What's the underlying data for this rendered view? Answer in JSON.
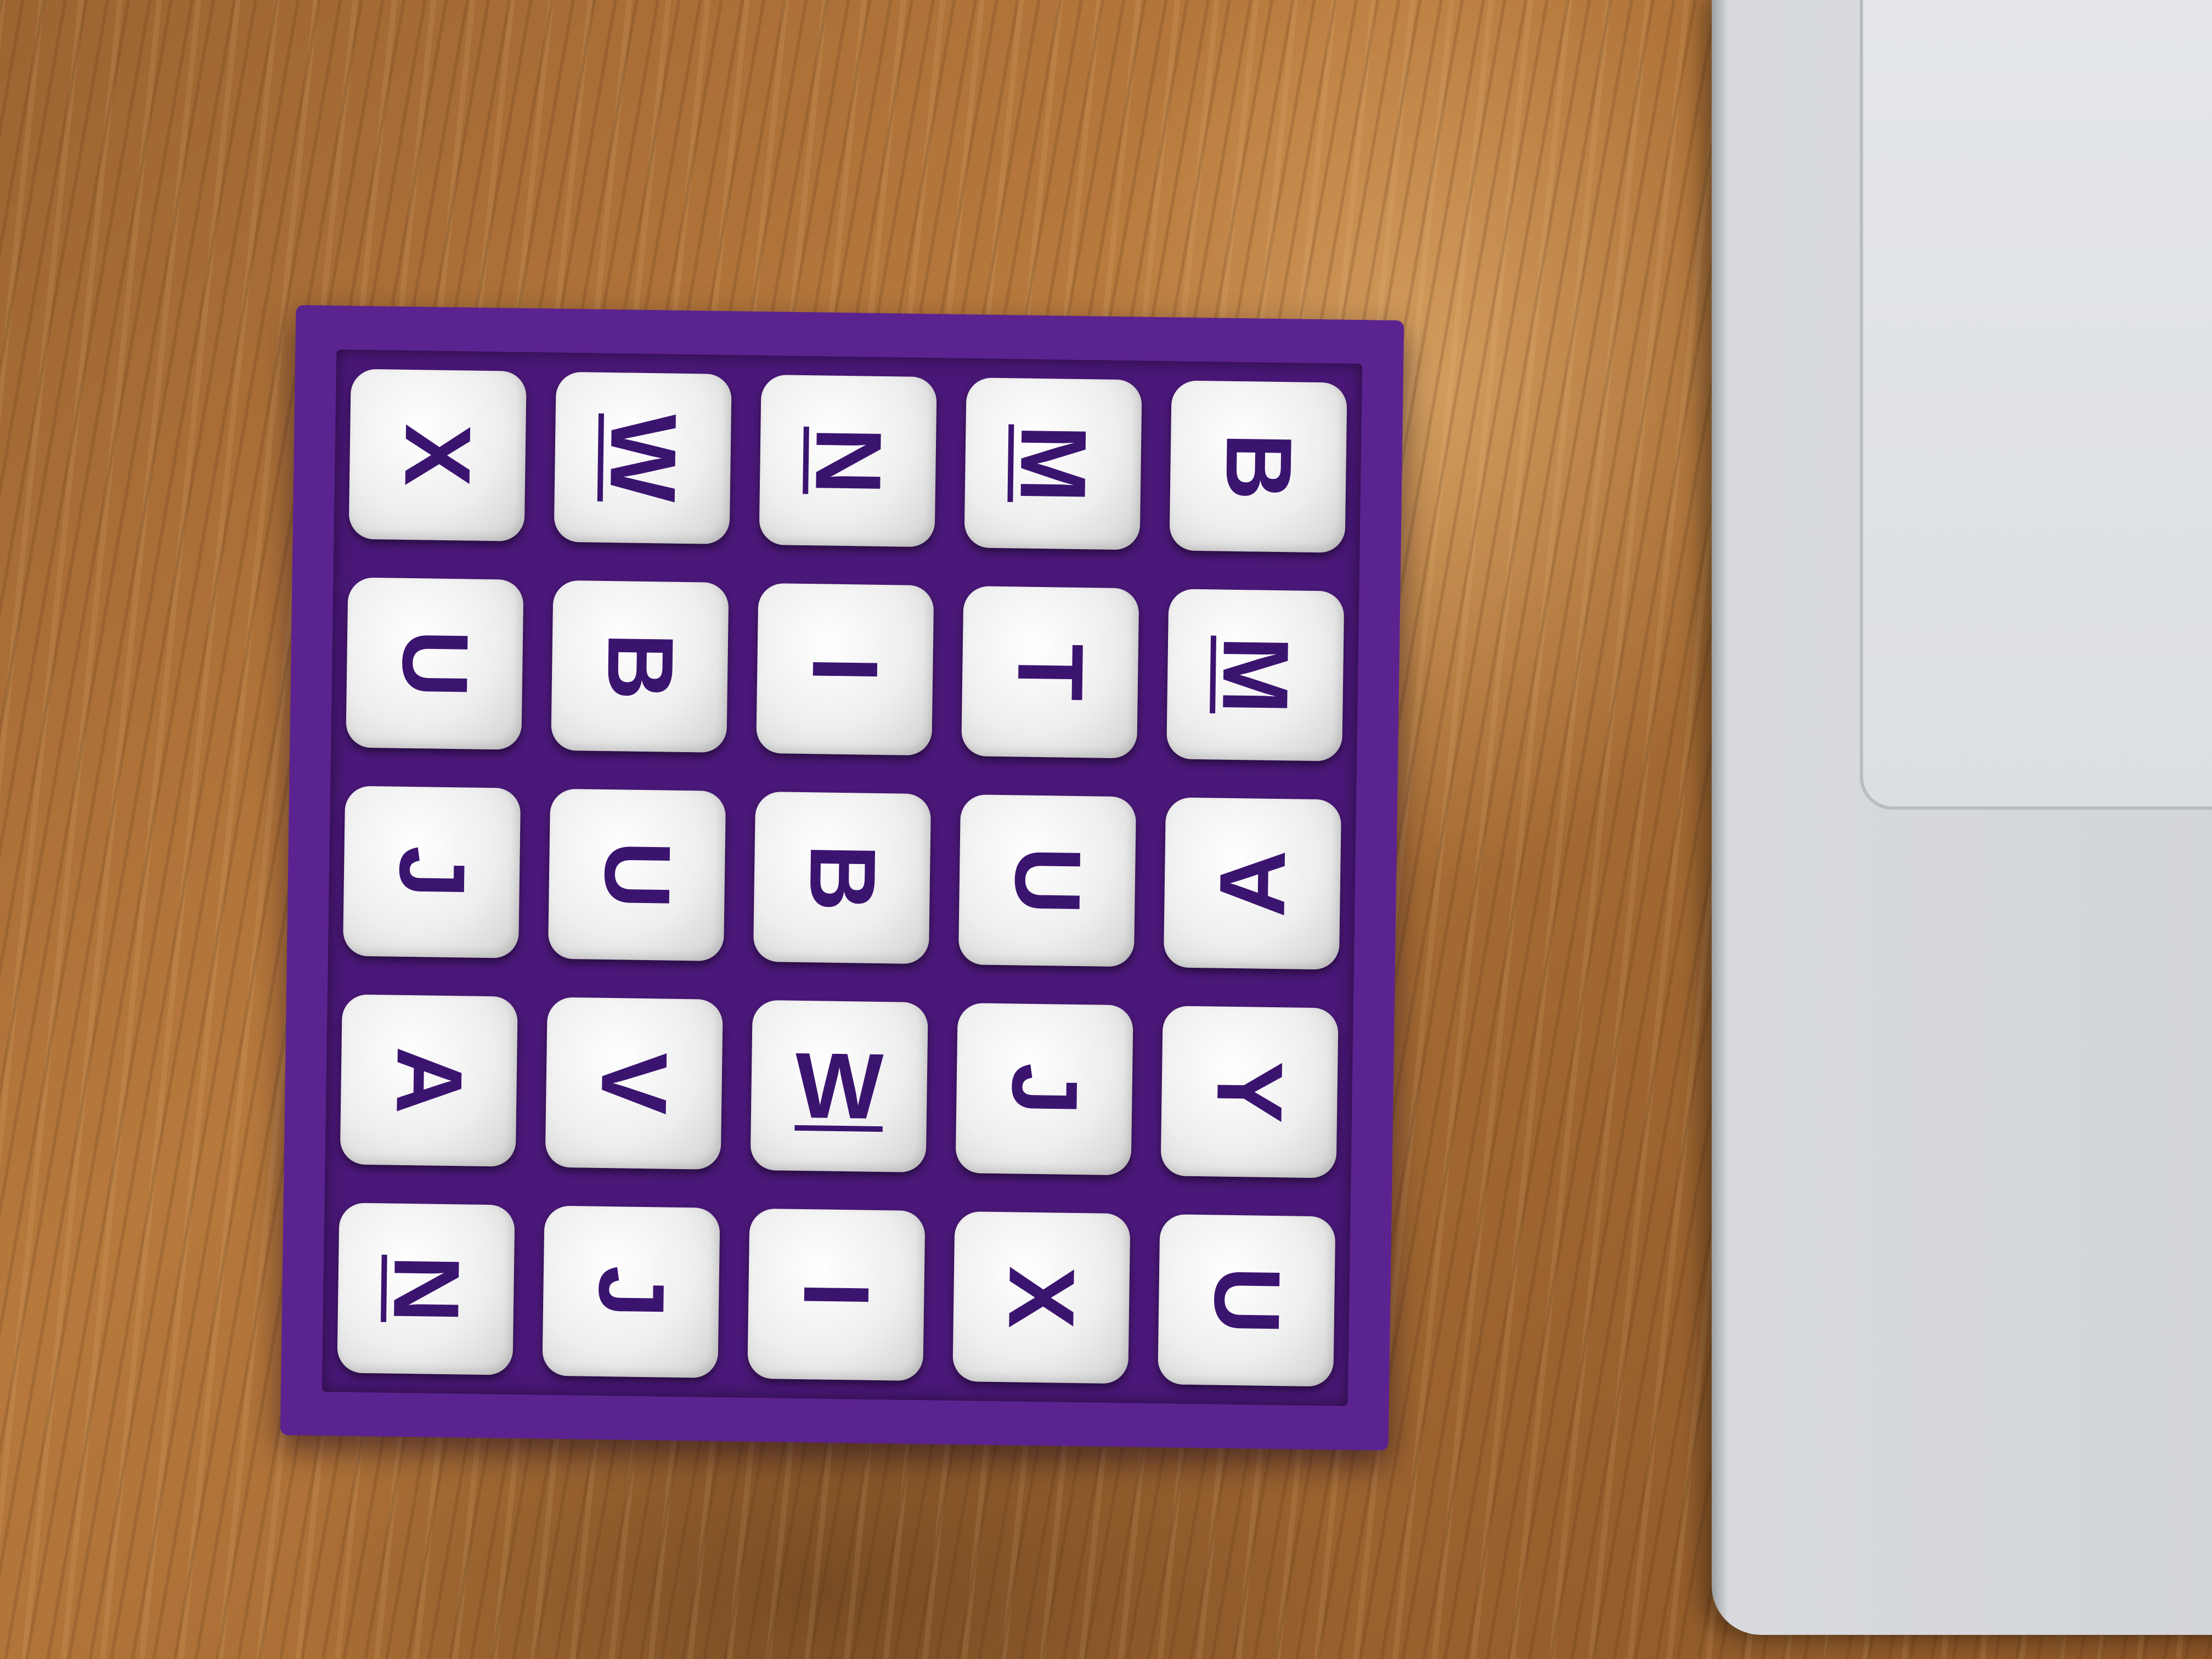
{
  "scene": {
    "board_color": "#5b2390",
    "die_color": "#f2f2f2",
    "letter_color": "#3b1470"
  },
  "board": {
    "rows": [
      [
        {
          "letter": "X",
          "rotation": 90,
          "underline": false
        },
        {
          "letter": "W",
          "rotation": 90,
          "underline": true
        },
        {
          "letter": "N",
          "rotation": 90,
          "underline": true
        },
        {
          "letter": "M",
          "rotation": 90,
          "underline": true
        },
        {
          "letter": "B",
          "rotation": 90,
          "underline": false
        }
      ],
      [
        {
          "letter": "U",
          "rotation": 90,
          "underline": false
        },
        {
          "letter": "B",
          "rotation": 90,
          "underline": false
        },
        {
          "letter": "I",
          "rotation": 90,
          "underline": false
        },
        {
          "letter": "T",
          "rotation": 90,
          "underline": false
        },
        {
          "letter": "M",
          "rotation": 90,
          "underline": true
        }
      ],
      [
        {
          "letter": "J",
          "rotation": 90,
          "underline": false
        },
        {
          "letter": "U",
          "rotation": 90,
          "underline": false
        },
        {
          "letter": "B",
          "rotation": 90,
          "underline": false
        },
        {
          "letter": "U",
          "rotation": 90,
          "underline": false
        },
        {
          "letter": "A",
          "rotation": -90,
          "underline": false
        }
      ],
      [
        {
          "letter": "A",
          "rotation": 90,
          "underline": false
        },
        {
          "letter": "V",
          "rotation": 90,
          "underline": false
        },
        {
          "letter": "W",
          "rotation": 0,
          "underline": true
        },
        {
          "letter": "J",
          "rotation": 90,
          "underline": false
        },
        {
          "letter": "Y",
          "rotation": 90,
          "underline": false
        }
      ],
      [
        {
          "letter": "N",
          "rotation": 90,
          "underline": true
        },
        {
          "letter": "J",
          "rotation": 90,
          "underline": false
        },
        {
          "letter": "I",
          "rotation": 90,
          "underline": false
        },
        {
          "letter": "X",
          "rotation": 90,
          "underline": false
        },
        {
          "letter": "U",
          "rotation": 90,
          "underline": false
        }
      ]
    ]
  }
}
